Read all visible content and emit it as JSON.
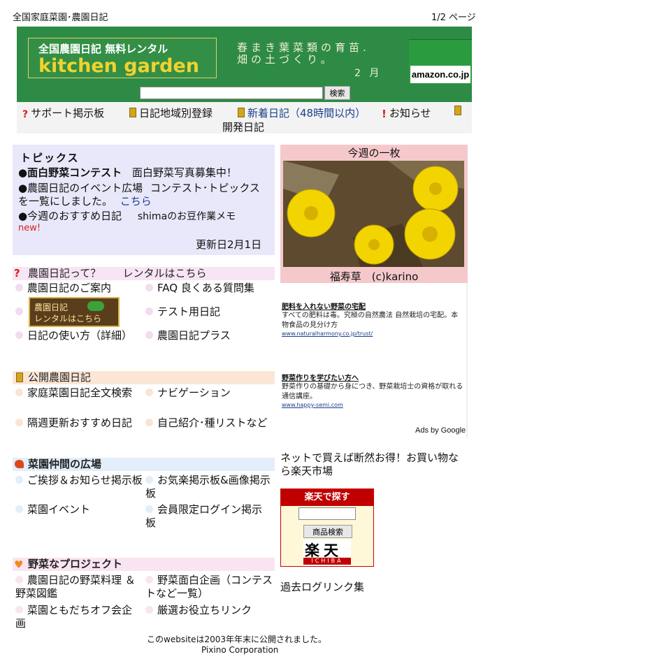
{
  "header": {
    "title": "全国家庭菜園･農園日記",
    "page": "1/2 ページ"
  },
  "banner": {
    "logo_top": "全国農園日記 無料レンタル",
    "logo_main": "kitchen garden",
    "tagline_1": "春まき葉菜類の育苗.",
    "tagline_2": "畑の土づくり。",
    "month": "2 月",
    "amazon": "amazon.co.jp",
    "search_placeholder": "",
    "search_button": "検索"
  },
  "nav": {
    "support": "サポート掲示板",
    "region": "日記地域別登録",
    "new_diary": "新着日記（48時間以内）",
    "news": "お知らせ",
    "dev_diary": "開発日記"
  },
  "topics": {
    "heading": "トピックス",
    "t1_bold": "●面白野菜コンテスト",
    "t1_text": "面白野菜写真募集中！",
    "t2_bold": "●農園日記のイベント広場",
    "t2_text": "コンテスト･トピックス",
    "t2_line2": "を一覧にしました。",
    "t2_link": "こちら",
    "t3_bold": "●今週のおすすめ日記",
    "t3_text": "shimaのお豆作業メモ",
    "new_badge": "new!",
    "updated": "更新日2月1日"
  },
  "photo": {
    "heading": "今週の一枚",
    "caption": "福寿草　(c)karino"
  },
  "about": {
    "title": "農園日記って？",
    "rental": "レンタルはこちら",
    "items": [
      "農園日記のご案内",
      "FAQ 良くある質問集",
      "テスト用日記",
      "日記の使い方（詳細）",
      "農園日記プラス"
    ],
    "rental_badge_1": "農園日記",
    "rental_badge_2": "レンタルはこちら"
  },
  "public": {
    "title": "公開農園日記",
    "items": [
      "家庭菜園日記全文検索",
      "ナビゲーション",
      "隔週更新おすすめ日記",
      "自己紹介･種リストなど"
    ]
  },
  "plaza": {
    "title": "菜園仲間の広場",
    "items": [
      "ご挨拶＆お知らせ掲示板",
      "お気楽掲示板&画像掲示板",
      "菜園イベント",
      "会員限定ログイン掲示板"
    ]
  },
  "project": {
    "title": "野菜なプロジェクト",
    "items": [
      "農園日記の野菜料理 ＆ 野菜図鑑",
      "野菜面白企画（コンテストなど一覧）",
      "菜園ともだちオフ会企画",
      "厳選お役立ちリンク"
    ]
  },
  "ads": [
    {
      "title": "肥料を入れない野菜の宅配",
      "text": "すべての肥料は毒。究極の自然農法 自然栽培の宅配。本物食品の見分け方",
      "url": "www.naturalharmony.co.jp/trust/"
    },
    {
      "title": "野菜作りを学びたい方へ",
      "text": "野菜作りの基礎から身につき、野菜栽培士の資格が取れる通信講座。",
      "url": "www.happy-semi.com"
    }
  ],
  "ads_by": "Ads by Google",
  "rakuten": {
    "promo": "ネットで買えば断然お得！お買い物なら楽天市場",
    "head": "楽天で探す",
    "button": "商品検索",
    "logo": "楽天",
    "logo_sub": "ICHIBA"
  },
  "archive": "過去ログリンク集",
  "footer": {
    "line1": "このwebsiteは2003年年末に公開されました。",
    "line2": "Pixino Corporation"
  },
  "colors": {
    "banner": "#2e8b45",
    "topics_bg": "#e8e8fa",
    "photo_bg": "#f5c9cc",
    "rakuten_red": "#c00000"
  }
}
